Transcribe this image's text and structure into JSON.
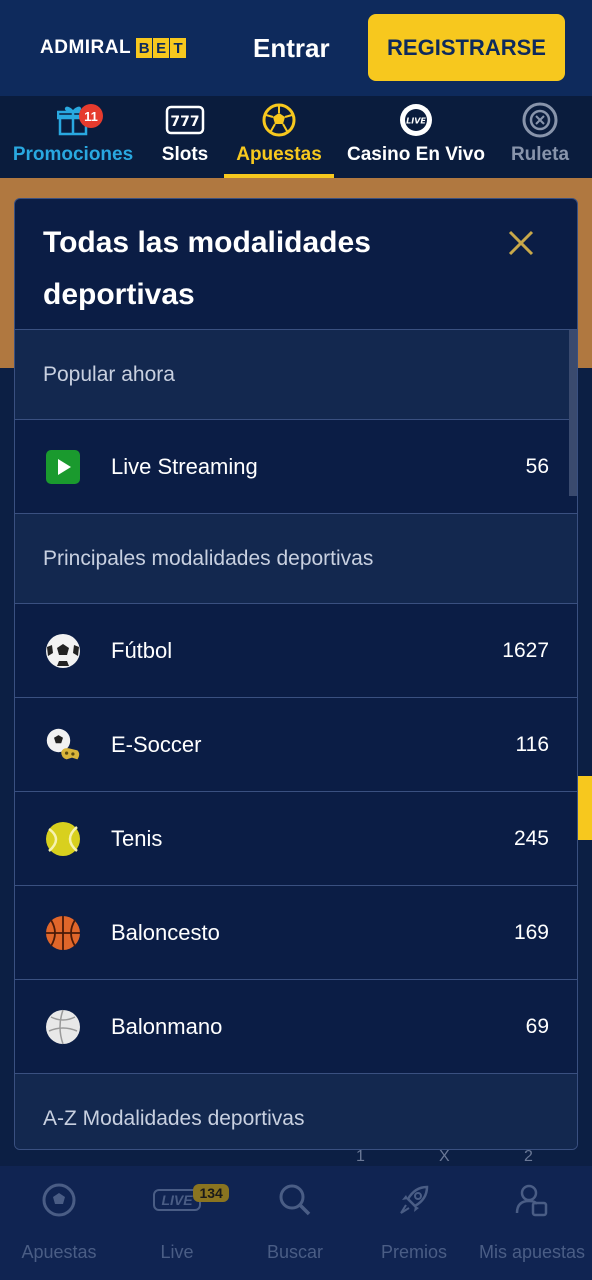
{
  "header": {
    "logo_text": "ADMIRAL",
    "logo_bet": [
      "B",
      "E",
      "T"
    ],
    "login_label": "Entrar",
    "register_label": "REGISTRARSE"
  },
  "categories": [
    {
      "label": "Promociones",
      "icon": "gift-icon",
      "badge": "11",
      "color": "#29a8e0"
    },
    {
      "label": "Slots",
      "icon": "slot-machine-icon"
    },
    {
      "label": "Apuestas",
      "icon": "soccer-ball-icon",
      "active": true
    },
    {
      "label": "Casino En Vivo",
      "icon": "live-chip-icon"
    },
    {
      "label": "Ruleta",
      "icon": "roulette-icon"
    }
  ],
  "modal": {
    "title": "Todas las modalidades deportivas",
    "close_icon": "close-icon",
    "sections": {
      "popular": "Popular ahora",
      "principales": "Principales modalidades deportivas",
      "az": "A-Z Modalidades deportivas"
    },
    "popular_items": [
      {
        "name": "Live Streaming",
        "count": "56",
        "icon": "play-icon"
      }
    ],
    "sport_items": [
      {
        "name": "Fútbol",
        "count": "1627",
        "icon": "football-icon"
      },
      {
        "name": "E-Soccer",
        "count": "116",
        "icon": "esoccer-icon"
      },
      {
        "name": "Tenis",
        "count": "245",
        "icon": "tennis-ball-icon"
      },
      {
        "name": "Baloncesto",
        "count": "169",
        "icon": "basketball-icon"
      },
      {
        "name": "Balonmano",
        "count": "69",
        "icon": "handball-icon"
      }
    ]
  },
  "background_odds": [
    "1",
    "X",
    "2"
  ],
  "bottom_nav": [
    {
      "label": "Apuestas",
      "icon": "soccer-ball-icon"
    },
    {
      "label": "Live",
      "icon": "live-icon",
      "badge": "134"
    },
    {
      "label": "Buscar",
      "icon": "search-icon"
    },
    {
      "label": "Premios",
      "icon": "rocket-icon"
    },
    {
      "label": "Mis apuestas",
      "icon": "my-bets-icon"
    }
  ],
  "colors": {
    "brand_yellow": "#f7c81e",
    "header_blue": "#0e2a5c",
    "promo_blue": "#29a8e0",
    "badge_red": "#e63b2e"
  }
}
